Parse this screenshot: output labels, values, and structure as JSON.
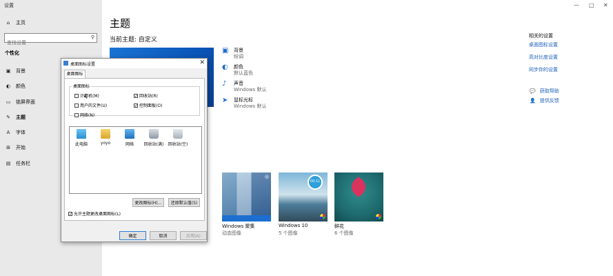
{
  "app": {
    "title": "设置"
  },
  "window_controls": {
    "minimize": "—",
    "maximize": "□",
    "close": "✕"
  },
  "sidebar": {
    "home": "主页",
    "search_placeholder": "查找设置",
    "section": "个性化",
    "items": [
      {
        "label": "背景",
        "icon": "picture-icon"
      },
      {
        "label": "颜色",
        "icon": "palette-icon"
      },
      {
        "label": "锁屏界面",
        "icon": "lock-screen-icon"
      },
      {
        "label": "主题",
        "icon": "theme-icon"
      },
      {
        "label": "字体",
        "icon": "font-icon"
      },
      {
        "label": "开始",
        "icon": "start-icon"
      },
      {
        "label": "任务栏",
        "icon": "taskbar-icon"
      }
    ]
  },
  "main": {
    "title": "主题",
    "current_theme": "当前主题: 自定义",
    "properties": [
      {
        "title": "背景",
        "sub": "纷调",
        "icon": "picture-icon"
      },
      {
        "title": "颜色",
        "sub": "默认蓝色",
        "icon": "palette-icon"
      },
      {
        "title": "声音",
        "sub": "Windows 默认",
        "icon": "speaker-icon"
      },
      {
        "title": "鼠标光标",
        "sub": "Windows 默认",
        "icon": "cursor-icon"
      }
    ],
    "themes": [
      {
        "name": "Windows 聚集",
        "sub": "动态图像"
      },
      {
        "name": "Windows 10",
        "sub": "5 个图像"
      },
      {
        "name": "鲜花",
        "sub": "6 个图像"
      }
    ],
    "theme_clock": "00:11"
  },
  "related": {
    "heading": "相关的设置",
    "links": [
      "桌面图标设置",
      "高对比度设置",
      "同步你的设置"
    ],
    "help": [
      {
        "label": "获取帮助",
        "icon": "help-chat-icon"
      },
      {
        "label": "提供反馈",
        "icon": "feedback-icon"
      }
    ]
  },
  "dialog": {
    "title": "桌面图标设置",
    "tab": "桌面图标",
    "group": "桌面图标",
    "checkboxes": [
      {
        "label": "计算机(M)",
        "checked": false
      },
      {
        "label": "回收站(R)",
        "checked": true
      },
      {
        "label": "用户的文件(U)",
        "checked": false
      },
      {
        "label": "控制面板(O)",
        "checked": true
      },
      {
        "label": "网络(N)",
        "checked": false
      }
    ],
    "icons": [
      {
        "label": "此电脑",
        "icon": "computer-icon"
      },
      {
        "label": "yoyo",
        "icon": "user-folder-icon"
      },
      {
        "label": "网络",
        "icon": "network-icon"
      },
      {
        "label": "回收站(满)",
        "icon": "recycle-bin-full-icon"
      },
      {
        "label": "回收站(空)",
        "icon": "recycle-bin-empty-icon"
      }
    ],
    "change_icon": "更改图标(H)...",
    "restore_default": "还原默认值(S)",
    "allow_themes": "允许主题更改桌面图标(L)",
    "ok": "确定",
    "cancel": "取消",
    "apply": "应用(A)",
    "close": "✕"
  }
}
